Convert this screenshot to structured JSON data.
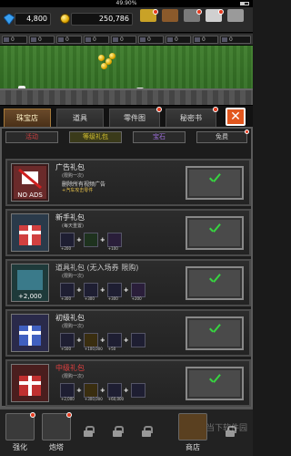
{
  "status": {
    "battery_text": "49.90%"
  },
  "topbar": {
    "gems": "4,800",
    "coins": "250,786",
    "icons": [
      {
        "name": "trophy-icon",
        "label": "",
        "color": "#c9a227"
      },
      {
        "name": "chest-icon",
        "label": "",
        "color": "#8b5a2b"
      },
      {
        "name": "card-icon",
        "label": "",
        "color": "#7a7a7a"
      },
      {
        "name": "scroll-icon",
        "label": "",
        "color": "#d0d0d0"
      },
      {
        "name": "settings-icon",
        "label": "",
        "color": "#9a9a9a"
      }
    ]
  },
  "levelbar": [
    "0",
    "0",
    "0",
    "0",
    "0",
    "0",
    "0",
    "0",
    "0"
  ],
  "tabs": [
    {
      "label": "珠宝店",
      "active": true
    },
    {
      "label": "道具",
      "active": false
    },
    {
      "label": "零件图",
      "active": false
    },
    {
      "label": "秘密书",
      "active": false
    }
  ],
  "close_label": "✕",
  "subtabs": [
    {
      "label": "活动",
      "color": "#d04040"
    },
    {
      "label": "等级礼包",
      "color": "#d4c030"
    },
    {
      "label": "宝石",
      "color": "#a070e0"
    },
    {
      "label": "免费",
      "color": "#d0d0d0"
    }
  ],
  "cards": [
    {
      "title": "广告礼包",
      "sub": "(限购一次)",
      "desc": "删除所有视频广告",
      "desc2": "+汽车攻击零件",
      "pic_label": "NO ADS",
      "items": []
    },
    {
      "title": "新手礼包",
      "sub": "(每天重置)",
      "desc": "",
      "desc2": "",
      "pic_label": "",
      "items": [
        "+200",
        "",
        "+100"
      ]
    },
    {
      "title": "道具礼包 (无入场券 限购)",
      "sub": "(限购一次)",
      "desc": "",
      "desc2": "",
      "pic_label": "+2,000",
      "items": [
        "+300",
        "+300",
        "+300",
        "+200"
      ]
    },
    {
      "title": "初级礼包",
      "sub": "(限购一次)",
      "desc": "",
      "desc2": "",
      "pic_label": "",
      "items": [
        "+500",
        "+100,000",
        "+50",
        ""
      ]
    },
    {
      "title": "中级礼包",
      "sub": "(限购一次)",
      "desc": "",
      "desc2": "",
      "pic_label": "",
      "items": [
        "+2,000",
        "+300,000",
        "+60,000",
        ""
      ]
    }
  ],
  "bottombar": [
    {
      "label": "强化",
      "locked": false
    },
    {
      "label": "炮塔",
      "locked": false
    },
    {
      "label": "",
      "locked": true
    },
    {
      "label": "",
      "locked": true
    },
    {
      "label": "",
      "locked": true
    },
    {
      "label": "商店",
      "locked": false
    },
    {
      "label": "",
      "locked": true
    }
  ],
  "watermark": "当下软件园"
}
